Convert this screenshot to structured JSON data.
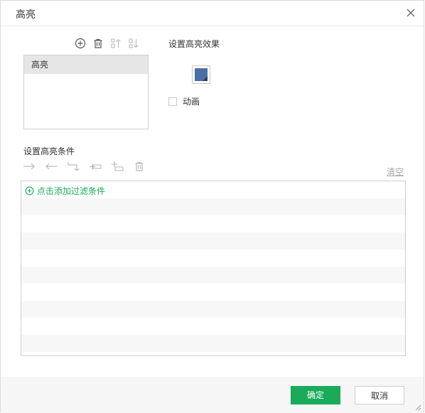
{
  "dialog": {
    "title": "高亮"
  },
  "list": {
    "toolbar": [
      "add-icon",
      "delete-icon",
      "move-up-icon",
      "move-down-icon"
    ],
    "items": [
      {
        "label": "高亮",
        "selected": true
      }
    ]
  },
  "effect": {
    "label": "设置高亮效果",
    "color": "#4a6fa5",
    "animation_label": "动画",
    "animation_checked": false
  },
  "conditions": {
    "label": "设置高亮条件",
    "toolbar": [
      "indent-right-icon",
      "indent-left-icon",
      "wrap-icon",
      "insert-above-icon",
      "insert-below-icon",
      "delete-icon"
    ],
    "clear_label": "清空",
    "add_filter_label": "点击添加过滤条件"
  },
  "footer": {
    "ok_label": "确定",
    "cancel_label": "取消"
  },
  "colors": {
    "accent": "#1aab5a",
    "selected_row": "#e6e6e6"
  }
}
